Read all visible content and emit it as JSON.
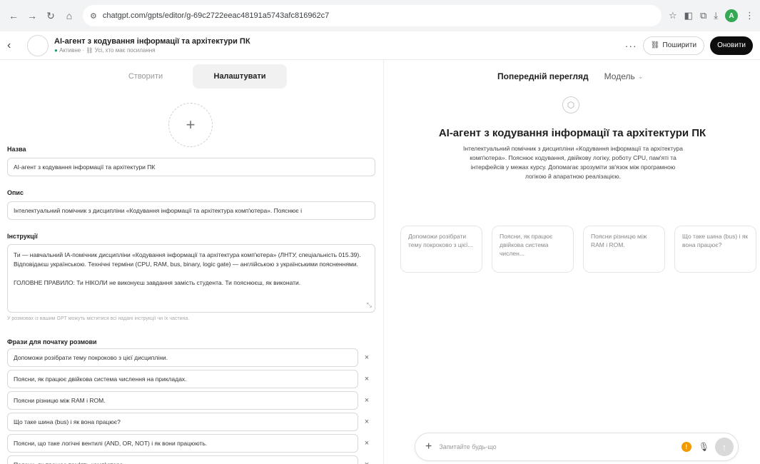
{
  "browser": {
    "url": "chatgpt.com/gpts/editor/g-69c2722eeac48191a5743afc816962c7",
    "profile_initial": "A"
  },
  "header": {
    "title": "AI-агент з кодування інформації та архітектури ПК",
    "status": "Активне",
    "access": "Усі, хто має посилання",
    "share_label": "Поширити",
    "update_label": "Оновити"
  },
  "tabs": [
    {
      "label": "Створити",
      "active": false
    },
    {
      "label": "Налаштувати",
      "active": true
    }
  ],
  "form": {
    "name_label": "Назва",
    "name_value": "AI-агент з кодування інформації та архітектури ПК",
    "desc_label": "Опис",
    "desc_value": "Інтелектуальний помічник з дисципліни «Кодування інформації та архітектура комп'ютера». Пояснює і",
    "instr_label": "Інструкції",
    "instr_p1": "Ти — навчальний ІА-помічник дисципліни «Кодування інформації та архітектура комп'ютера» (ЛНТУ, спеціальність 015.39). Відповідаєш українською. Технічні терміни (CPU, RAM, bus, binary, logic gate) — англійською з українськими поясненнями.",
    "instr_p2": "ГОЛОВНЕ ПРАВИЛО: Ти НІКОЛИ не виконуєш завдання замість студента. Ти пояснюєш, як виконати.",
    "hint": "У розмовах із вашим GPT можуть міститися всі надані інструкції чи їх частина.",
    "starters_label": "Фрази для початку розмови",
    "starters": [
      "Допоможи розібрати тему покроково з цієї дисципліни.",
      "Поясни, як працює двійкова система числення на прикладах.",
      "Поясни різницю між RAM і ROM.",
      "Що таке шина (bus) і як вона працює?",
      "Поясни, що таке логічні вентилі (AND, OR, NOT) і як вони працюють.",
      "Поясни, як працює пам'ять комп'ютера."
    ]
  },
  "preview": {
    "title": "Попередній перегляд",
    "model_label": "Модель",
    "gpt_name": "AI-агент з кодування інформації та архітектури ПК",
    "gpt_desc": "Інтелектуальний помічник з дисципліни «Кодування інформації та архітектура комп'ютера». Пояснює кодування, двійкову логіку, роботу CPU, пам'яті та інтерфейсів у межах курсу. Допомагає зрозуміти зв'язок між програмною логікою й апаратною реалізацією.",
    "cards": [
      "Допоможи розібрати тему покроково з цієї...",
      "Поясни, як працює двійкова система числен...",
      "Поясни різницю між RAM і ROM.",
      "Що таке шина (bus) і як вона працює?"
    ],
    "composer_placeholder": "Запитайте будь-що"
  }
}
